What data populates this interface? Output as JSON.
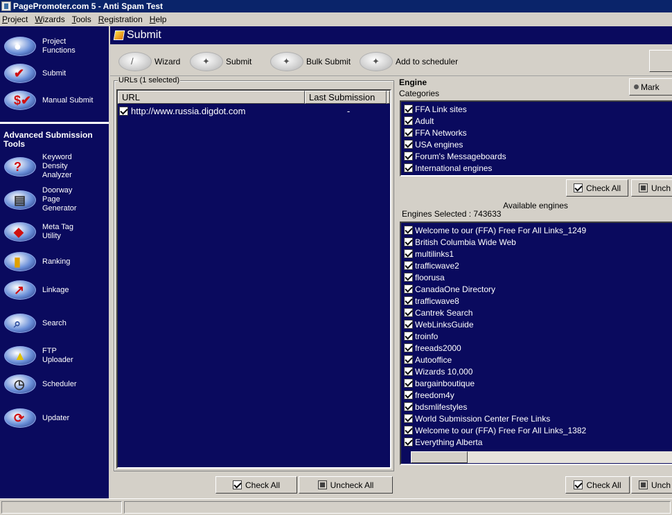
{
  "window": {
    "title": "PagePromoter.com 5 - Anti Spam Test"
  },
  "menu": [
    {
      "label": "Project",
      "u": "P",
      "rest": "roject"
    },
    {
      "label": "Wizards",
      "u": "W",
      "rest": "izards"
    },
    {
      "label": "Tools",
      "u": "T",
      "rest": "ools"
    },
    {
      "label": "Registration",
      "u": "R",
      "rest": "egistration"
    },
    {
      "label": "Help",
      "u": "H",
      "rest": "elp"
    }
  ],
  "sidebar": {
    "top_items": [
      {
        "label": "Project\nFunctions",
        "icon": "project-functions-icon"
      },
      {
        "label": "Submit",
        "icon": "submit-icon"
      },
      {
        "label": "Manual Submit",
        "icon": "manual-submit-icon"
      }
    ],
    "advanced_heading": "Advanced Submission\nTools",
    "advanced_items": [
      {
        "label": "Keyword\nDensity\nAnalyzer",
        "icon": "keyword-density-icon"
      },
      {
        "label": "Doorway\nPage\nGenerator",
        "icon": "doorway-page-icon"
      },
      {
        "label": "Meta Tag\nUtility",
        "icon": "meta-tag-icon"
      },
      {
        "label": "Ranking",
        "icon": "ranking-icon"
      },
      {
        "label": "Linkage",
        "icon": "linkage-icon"
      },
      {
        "label": "Search",
        "icon": "search-icon"
      },
      {
        "label": "FTP\nUploader",
        "icon": "ftp-uploader-icon"
      },
      {
        "label": "Scheduler",
        "icon": "scheduler-icon"
      },
      {
        "label": "Updater",
        "icon": "updater-icon"
      }
    ]
  },
  "main": {
    "title": "Submit",
    "toolbar": {
      "wizard": "Wizard",
      "submit": "Submit",
      "bulk_submit": "Bulk Submit",
      "add_scheduler": "Add to scheduler"
    },
    "urls": {
      "group_label": "URLs (1 selected)",
      "col_url": "URL",
      "col_last": "Last Submission",
      "rows": [
        {
          "url": "http://www.russia.digdot.com",
          "last": "-",
          "checked": true
        }
      ]
    },
    "engine": {
      "title": "Engine",
      "categories_label": "Categories",
      "mark_button": "Mark",
      "categories": [
        "FFA Link sites",
        "Adult",
        "FFA Networks",
        "USA engines",
        "Forum's Messageboards",
        "International engines"
      ],
      "check_all": "Check All",
      "uncheck": "Unch",
      "available_label": "Available engines",
      "selected_label": "Engines Selected : 743633",
      "engines": [
        "Welcome to our (FFA) Free For All Links_1249",
        "British Columbia Wide Web",
        "multilinks1",
        "trafficwave2",
        "floorusa",
        "CanadaOne Directory",
        "trafficwave8",
        "Cantrek Search",
        "WebLinksGuide",
        "troinfo",
        "freeads2000",
        "Autooffice",
        "Wizards 10,000",
        "bargainboutique",
        "freedom4y",
        "bdsmlifestyles",
        "World Submission Center Free Links",
        "Welcome to our (FFA) Free For All Links_1382",
        "Everything Alberta"
      ]
    },
    "bottom": {
      "check_all": "Check All",
      "uncheck_all": "Uncheck All",
      "check_all_right": "Check All",
      "uncheck_right": "Unch"
    }
  }
}
